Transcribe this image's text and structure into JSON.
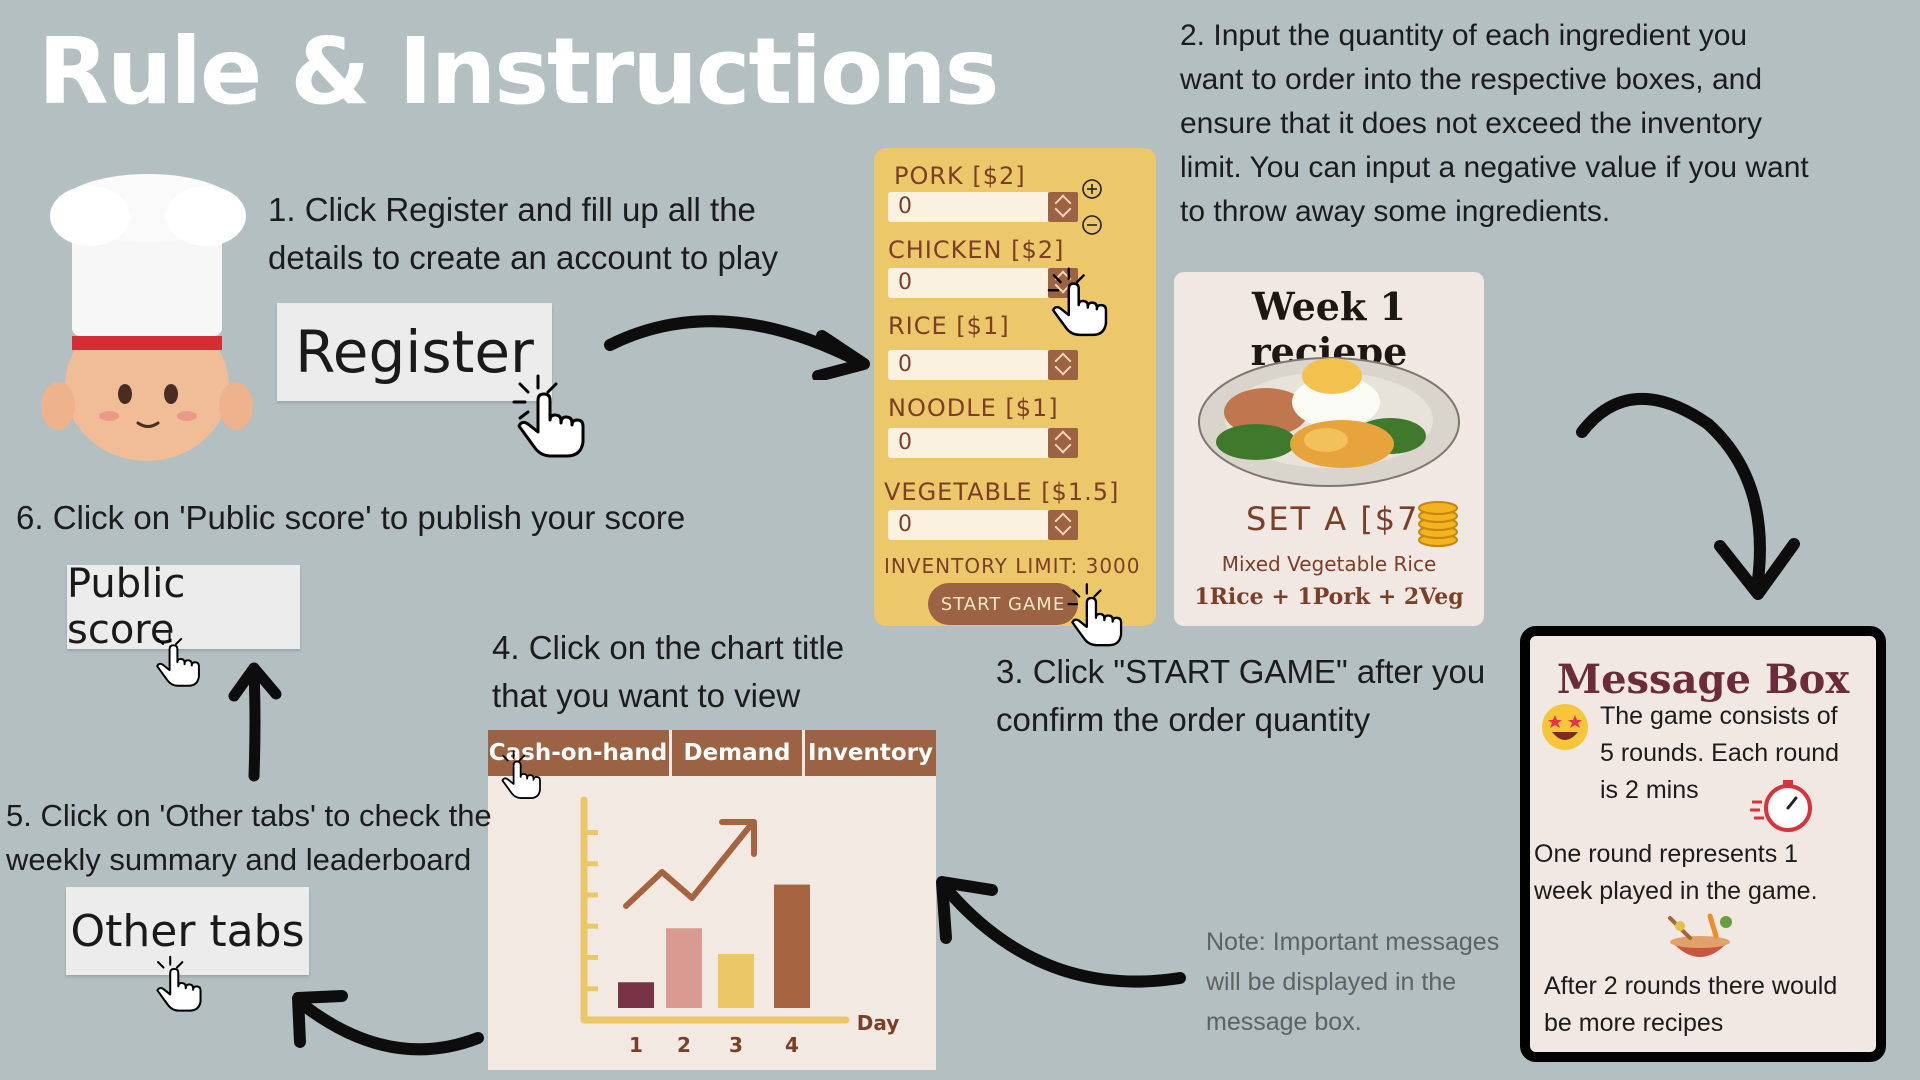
{
  "title": "Rule & Instructions",
  "steps": {
    "s1": [
      "1. Click Register and fill up all the",
      "details to create an account to play"
    ],
    "s2": [
      "2. Input the quantity of each ingredient you",
      "want to order into the respective boxes, and",
      "ensure that it does not exceed the inventory",
      "limit. You can input a negative value if you want",
      "to throw away some ingredients."
    ],
    "s3": [
      "3. Click \"START GAME\" after you",
      "confirm the order quantity"
    ],
    "s4": [
      "4.  Click on the chart title",
      "that you want to view"
    ],
    "s5": [
      "5. Click  on 'Other tabs' to check the",
      "weekly summary and leaderboard"
    ],
    "s6": "6. Click  on 'Public score' to publish your score"
  },
  "buttons": {
    "register": "Register",
    "public_score": "Public score",
    "other_tabs": "Other tabs"
  },
  "order": {
    "items": [
      {
        "label": "PORK [$2]",
        "value": "0"
      },
      {
        "label": "CHICKEN  [$2]",
        "value": "0"
      },
      {
        "label": "RICE [$1]",
        "value": "0"
      },
      {
        "label": "NOODLE [$1]",
        "value": "0"
      },
      {
        "label": "VEGETABLE [$1.5]",
        "value": "0"
      }
    ],
    "inventory_limit": "INVENTORY LIMIT: 3000",
    "start": "START GAME"
  },
  "recipe": {
    "title": "Week 1 reciepe",
    "set": "SET A [$7]",
    "name": "Mixed Vegetable Rice",
    "formula": "1Rice + 1Pork + 2Veg"
  },
  "chart_tabs": [
    "Cash-on-hand",
    "Demand",
    "Inventory"
  ],
  "chart_data": {
    "type": "bar",
    "categories": [
      "1",
      "2",
      "3",
      "4"
    ],
    "values": [
      1,
      3.1,
      2.1,
      4.8
    ],
    "xlabel": "Day",
    "ylabel": "",
    "ylim": [
      0,
      7
    ],
    "colors": [
      "#7a3346",
      "#d99a92",
      "#ebc767",
      "#a5633f"
    ]
  },
  "message_box": {
    "title": "Message Box",
    "p1": [
      "The game consists of",
      "5 rounds. Each round",
      "is 2 mins"
    ],
    "p2": [
      "One round represents 1",
      "week played in the game."
    ],
    "p3": [
      "After 2 rounds there would",
      "be more recipes"
    ]
  },
  "note": [
    "Note: Important messages",
    "will be displayed in the",
    "message box."
  ],
  "colors": {
    "background": "#b3bfc1",
    "order_panel": "#ecc86a",
    "accent_brown": "#9b6343",
    "card": "#f1e8e3",
    "message_title": "#6b2b3a"
  }
}
